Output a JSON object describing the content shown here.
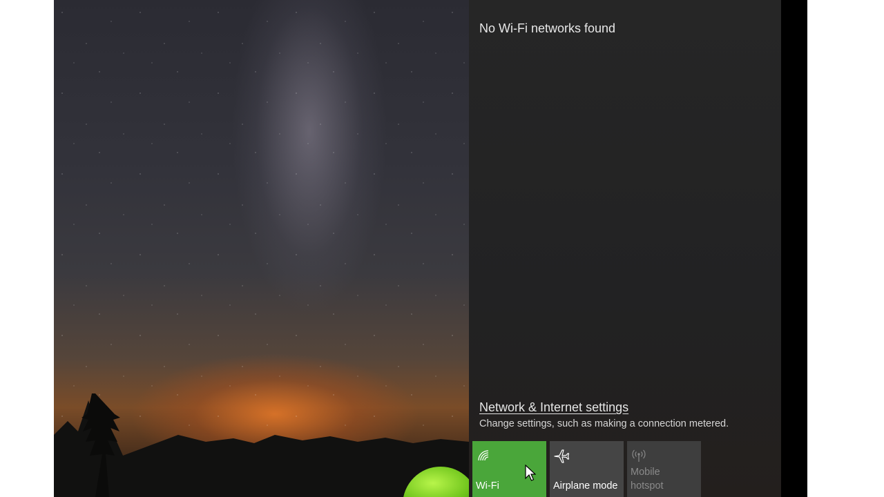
{
  "network_panel": {
    "status_text": "No Wi-Fi networks found",
    "settings_link": "Network & Internet settings",
    "settings_description": "Change settings, such as making a connection metered."
  },
  "quick_actions": [
    {
      "label": "Wi-Fi",
      "icon": "wifi-icon",
      "state": "on",
      "color": "#4aa63a"
    },
    {
      "label": "Airplane mode",
      "icon": "airplane-icon",
      "state": "off",
      "color": "#454545"
    },
    {
      "label": "Mobile hotspot",
      "icon": "hotspot-icon",
      "state": "disabled",
      "color": "#3e3e3e"
    }
  ],
  "colors": {
    "accent": "#4aa63a",
    "panel_background": "#262626"
  }
}
